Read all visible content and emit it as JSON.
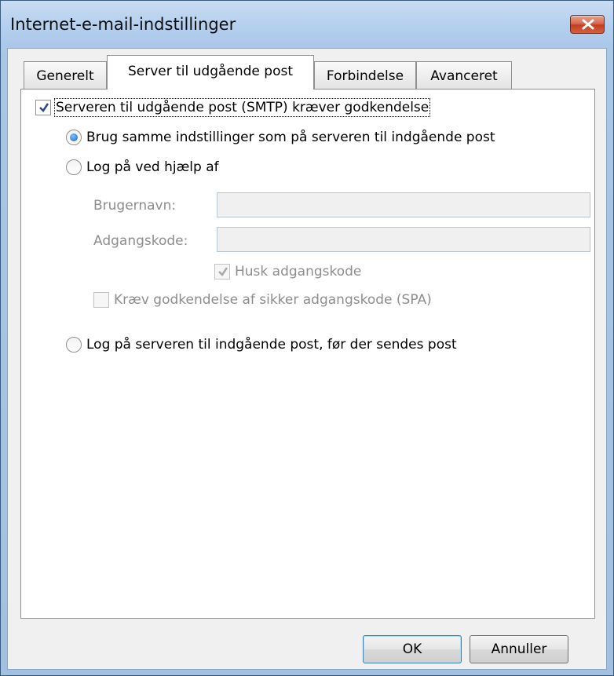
{
  "window": {
    "title": "Internet-e-mail-indstillinger"
  },
  "tabs": [
    {
      "label": "Generelt"
    },
    {
      "label": "Server til udgående post",
      "active": true
    },
    {
      "label": "Forbindelse"
    },
    {
      "label": "Avanceret"
    }
  ],
  "smtp_auth": {
    "label": "Serveren til udgående post (SMTP) kræver godkendelse",
    "checked": true
  },
  "options": {
    "same_settings": {
      "label": "Brug samme indstillinger som på serveren til indgående post",
      "selected": true
    },
    "log_on_using": {
      "label": "Log på ved hjælp af",
      "selected": false
    },
    "log_on_incoming_first": {
      "label": "Log på serveren til indgående post, før der sendes post",
      "selected": false
    }
  },
  "credentials": {
    "username_label": "Brugernavn:",
    "username_value": "",
    "password_label": "Adgangskode:",
    "password_value": "",
    "remember_password": {
      "label": "Husk adgangskode",
      "checked": true,
      "disabled": true
    },
    "require_spa": {
      "label": "Kræv godkendelse af sikker adgangskode (SPA)",
      "checked": false,
      "disabled": true
    }
  },
  "buttons": {
    "ok": "OK",
    "cancel": "Annuller"
  },
  "colors": {
    "titlebar": "#b6d0ee",
    "close_button": "#c94a2c",
    "checkmark": "#2a4a8a",
    "radio_dot": "#1b5fb5",
    "disabled_text": "#8d8d8d"
  }
}
